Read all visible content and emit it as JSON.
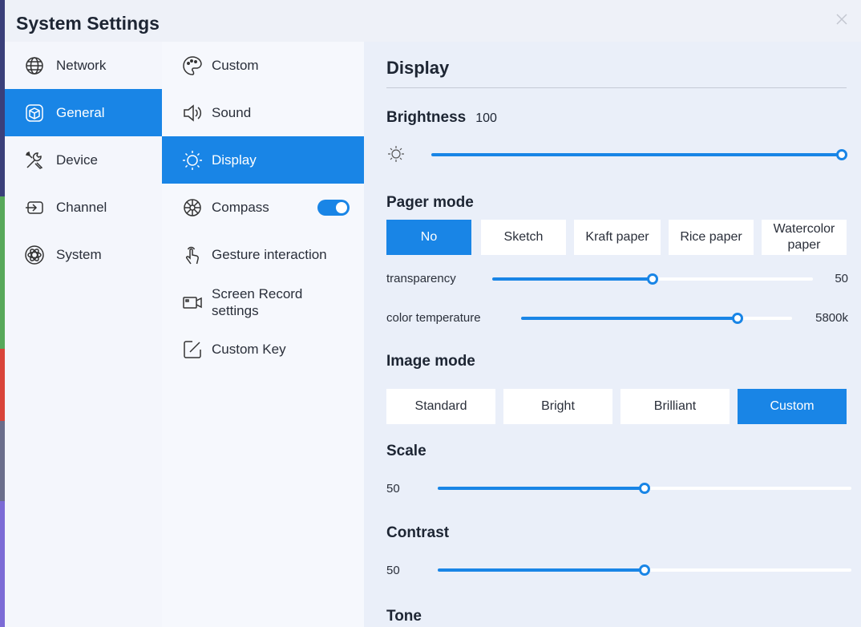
{
  "window": {
    "title": "System Settings"
  },
  "categories": [
    {
      "label": "Network",
      "icon": "globe-icon"
    },
    {
      "label": "General",
      "icon": "cube-icon",
      "active": true
    },
    {
      "label": "Device",
      "icon": "tools-icon"
    },
    {
      "label": "Channel",
      "icon": "input-icon"
    },
    {
      "label": "System",
      "icon": "atom-icon"
    }
  ],
  "subitems": [
    {
      "label": "Custom",
      "icon": "palette-icon"
    },
    {
      "label": "Sound",
      "icon": "speaker-icon"
    },
    {
      "label": "Display",
      "icon": "sun-icon",
      "active": true
    },
    {
      "label": "Compass",
      "icon": "compass-icon",
      "toggle": true
    },
    {
      "label": "Gesture interaction",
      "icon": "hand-pointer-icon"
    },
    {
      "label_line1": "Screen Record",
      "label_line2": "settings",
      "icon": "camera-icon"
    },
    {
      "label": "Custom Key",
      "icon": "edit-key-icon"
    }
  ],
  "display": {
    "heading": "Display",
    "brightness": {
      "label": "Brightness",
      "value": "100",
      "level": 1.0
    },
    "pager_mode": {
      "label": "Pager mode",
      "options": [
        "No",
        "Sketch",
        "Kraft paper",
        "Rice paper",
        "Watercolor paper"
      ],
      "watercolor_line1": "Watercolor",
      "watercolor_line2": "paper",
      "selected": "No"
    },
    "transparency": {
      "label": "transparency",
      "value": "50",
      "level": 0.5
    },
    "color_temperature": {
      "label": "color temperature",
      "value": "5800k",
      "level": 0.8
    },
    "image_mode": {
      "label": "Image mode",
      "options": [
        "Standard",
        "Bright",
        "Brilliant",
        "Custom"
      ],
      "selected": "Custom"
    },
    "scale": {
      "label": "Scale",
      "value": "50",
      "level": 0.5
    },
    "contrast": {
      "label": "Contrast",
      "value": "50",
      "level": 0.5
    },
    "tone": {
      "label": "Tone"
    }
  },
  "colors": {
    "accent": "#1985e6",
    "panel": "#eaeff9",
    "text": "#2a2f3a"
  }
}
